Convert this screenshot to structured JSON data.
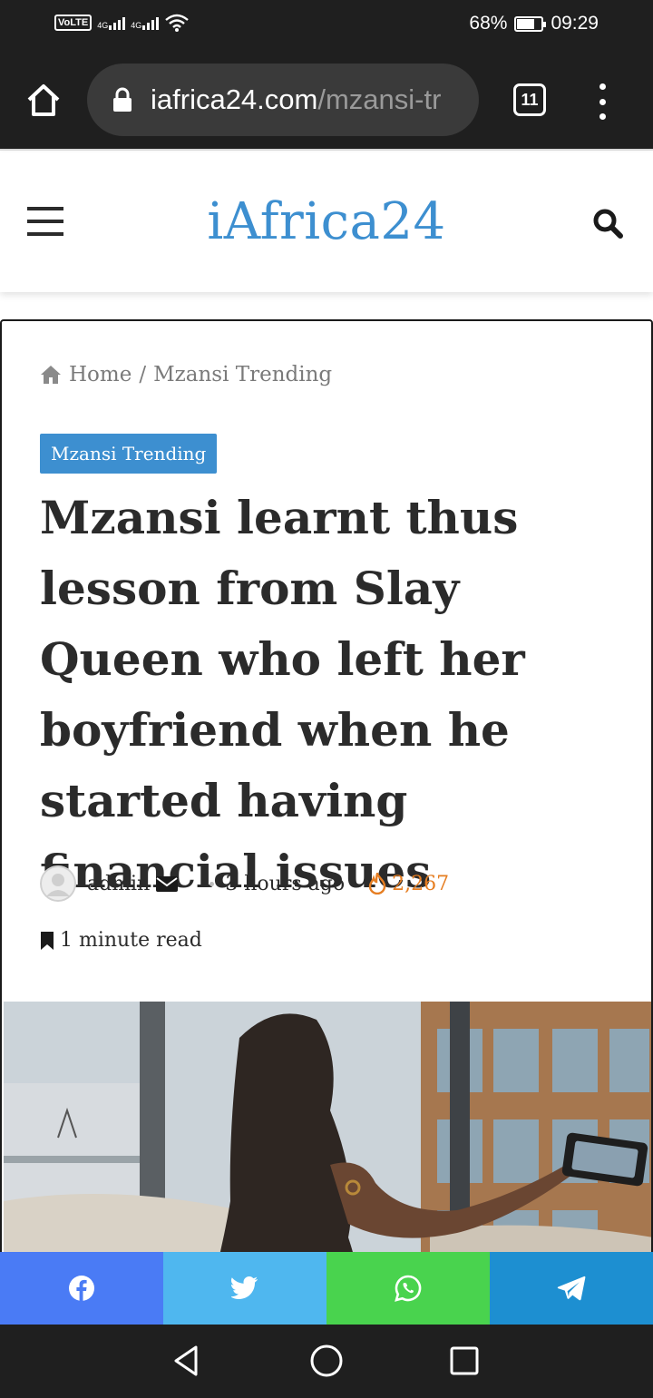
{
  "status_bar": {
    "network_label": "VoLTE",
    "sim1_type": "4G",
    "sim2_type": "4G",
    "battery_percent": "68%",
    "time": "09:29"
  },
  "browser": {
    "url_domain": "iafrica24.com",
    "url_path": "/mzansi-tr",
    "tab_count": "11"
  },
  "site": {
    "logo": "iAfrica24"
  },
  "breadcrumb": {
    "home": "Home",
    "separator": "/",
    "current": "Mzansi Trending"
  },
  "article": {
    "category": "Mzansi Trending",
    "title": "Mzansi learnt thus lesson from Slay Queen who left her boyfriend when he started having financial issues",
    "author": "admin",
    "time_ago": "3 hours ago",
    "views": "2,267",
    "read_time": "1 minute read"
  },
  "share": {
    "networks": [
      "facebook",
      "twitter",
      "whatsapp",
      "telegram"
    ]
  },
  "colors": {
    "brand_blue": "#3d8fd0",
    "views_orange": "#e67e22",
    "facebook": "#4a7bf5",
    "twitter": "#4fb7ef",
    "whatsapp": "#49d34e",
    "telegram": "#1d8fd1"
  },
  "icons": {
    "home": "home-icon",
    "lock": "lock-icon",
    "menu": "more-vertical-icon",
    "hamburger": "hamburger-icon",
    "search": "search-icon",
    "breadcrumb_home": "house-icon",
    "email": "envelope-icon",
    "views": "flame-icon",
    "read_time": "bookmark-icon"
  }
}
